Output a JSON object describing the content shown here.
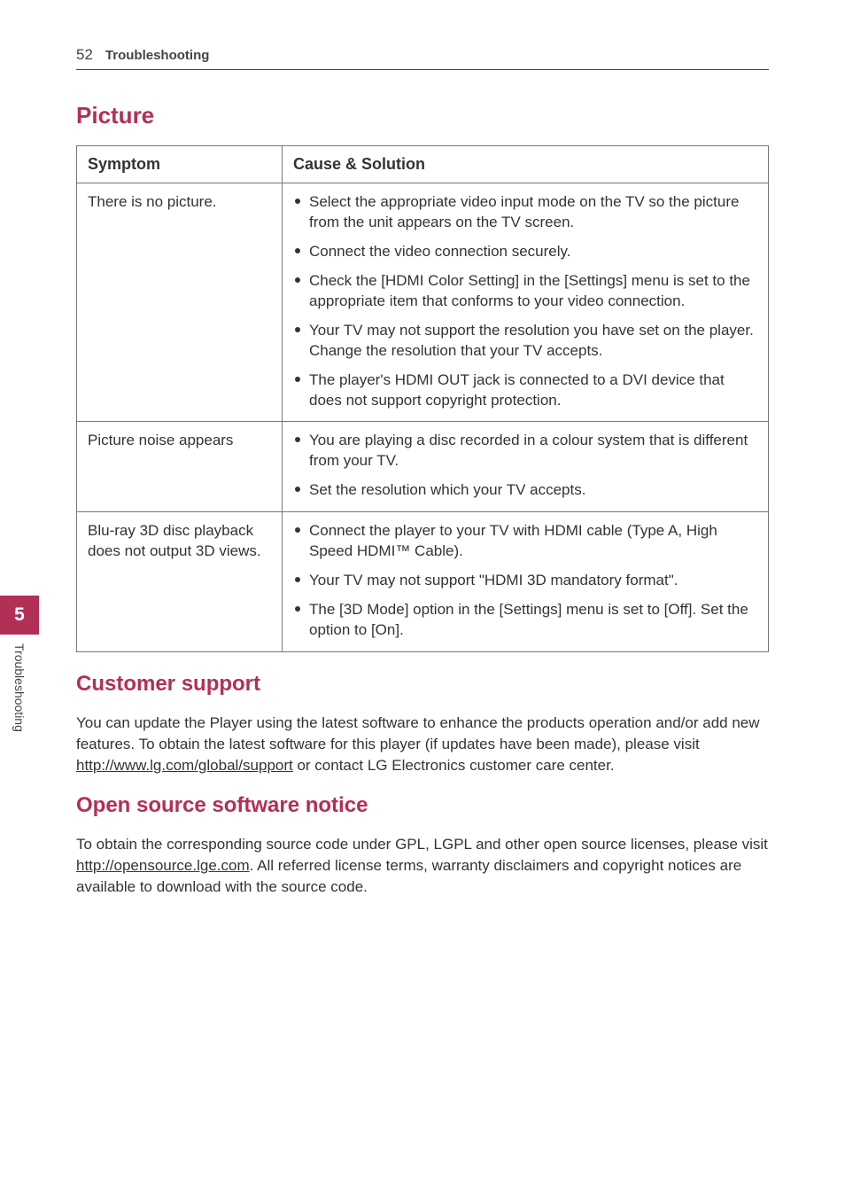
{
  "header": {
    "page_number": "52",
    "title": "Troubleshooting"
  },
  "side_tab": {
    "number": "5",
    "label": "Troubleshooting"
  },
  "sections": {
    "picture": {
      "heading": "Picture",
      "table_headers": {
        "symptom": "Symptom",
        "cause": "Cause & Solution"
      },
      "rows": [
        {
          "symptom": "There is no picture.",
          "solutions": [
            "Select the appropriate video input mode on the TV so the picture from the unit appears on the TV screen.",
            "Connect the video connection securely.",
            "Check the [HDMI Color Setting] in the [Settings] menu is set to the appropriate item that conforms to your video connection.",
            "Your TV may not support the resolution you have set on the player. Change the resolution that your TV accepts.",
            "The player's HDMI OUT jack is connected to a DVI device that does not support copyright protection."
          ]
        },
        {
          "symptom": "Picture noise appears",
          "solutions": [
            "You are playing a disc recorded in a colour system that is different from your TV.",
            "Set the resolution which your TV accepts."
          ]
        },
        {
          "symptom": "Blu-ray 3D disc playback does not output 3D views.",
          "solutions": [
            "Connect the player to your TV with HDMI cable (Type A, High Speed HDMI™ Cable).",
            "Your TV may not support \"HDMI 3D mandatory format\".",
            "The [3D Mode] option in the [Settings] menu is set to [Off]. Set the option to [On]."
          ]
        }
      ]
    },
    "customer_support": {
      "heading": "Customer support",
      "para_pre": "You can update the Player using the latest software to enhance the products operation and/or add new features. To obtain the latest software for this player (if updates have been made), please visit ",
      "link": "http://www.lg.com/global/support",
      "para_post": " or contact LG Electronics customer care center."
    },
    "open_source": {
      "heading": "Open source software notice",
      "para_pre": "To obtain the corresponding source code under GPL, LGPL and other open source licenses, please visit ",
      "link": "http://opensource.lge.com",
      "para_post": ". All referred license terms, warranty disclaimers and copyright notices are available to download with the source code."
    }
  }
}
